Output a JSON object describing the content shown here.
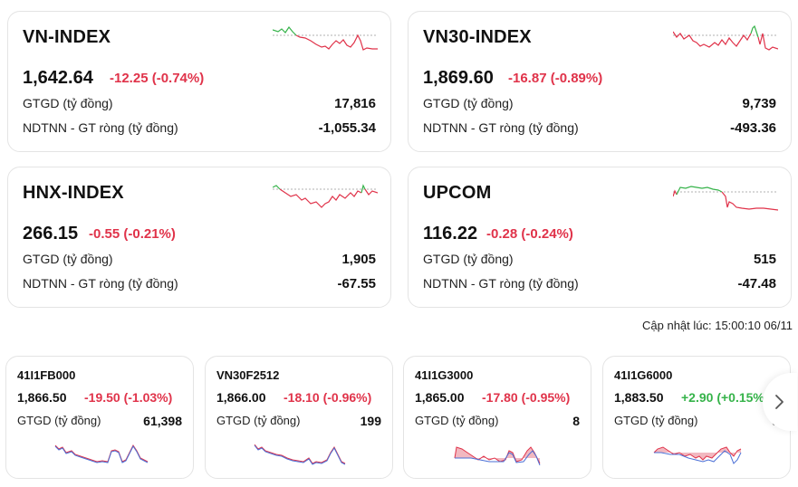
{
  "indices": [
    {
      "name": "VN-INDEX",
      "value": "1,642.64",
      "change": "-12.25 (-0.74%)",
      "volume_label": "GTGD (tỷ đồng)",
      "volume": "17,816",
      "foreign_label": "NDTNN - GT ròng (tỷ đồng)",
      "foreign": "-1,055.34"
    },
    {
      "name": "VN30-INDEX",
      "value": "1,869.60",
      "change": "-16.87 (-0.89%)",
      "volume_label": "GTGD (tỷ đồng)",
      "volume": "9,739",
      "foreign_label": "NDTNN - GT ròng (tỷ đồng)",
      "foreign": "-493.36"
    },
    {
      "name": "HNX-INDEX",
      "value": "266.15",
      "change": "-0.55 (-0.21%)",
      "volume_label": "GTGD (tỷ đồng)",
      "volume": "1,905",
      "foreign_label": "NDTNN - GT ròng (tỷ đồng)",
      "foreign": "-67.55"
    },
    {
      "name": "UPCOM",
      "value": "116.22",
      "change": "-0.28 (-0.24%)",
      "volume_label": "GTGD (tỷ đồng)",
      "volume": "515",
      "foreign_label": "NDTNN - GT ròng (tỷ đồng)",
      "foreign": "-47.48"
    }
  ],
  "updated": "Cập nhật lúc: 15:00:10 06/11",
  "futures": [
    {
      "name": "41I1FB000",
      "value": "1,866.50",
      "change": "-19.50 (-1.03%)",
      "direction": "down",
      "volume_label": "GTGD (tỷ đồng)",
      "volume": "61,398"
    },
    {
      "name": "VN30F2512",
      "value": "1,866.00",
      "change": "-18.10 (-0.96%)",
      "direction": "down",
      "volume_label": "GTGD (tỷ đồng)",
      "volume": "199"
    },
    {
      "name": "41I1G3000",
      "value": "1,865.00",
      "change": "-17.80 (-0.95%)",
      "direction": "down",
      "volume_label": "GTGD (tỷ đồng)",
      "volume": "8"
    },
    {
      "name": "41I1G6000",
      "value": "1,883.50",
      "change": "+2.90 (+0.15%)",
      "direction": "up",
      "volume_label": "GTGD (tỷ đồng)",
      "volume": "5"
    }
  ],
  "colors": {
    "down": "#e0334a",
    "up": "#36b34a",
    "futures_line": "#4a6fd6"
  },
  "icons": {
    "next": "chevron-right-icon"
  }
}
